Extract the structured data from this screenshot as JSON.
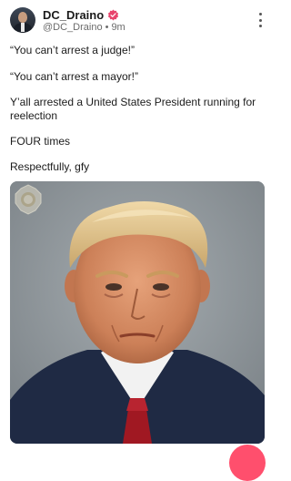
{
  "post": {
    "author": {
      "display_name": "DC_Draino",
      "handle": "@DC_Draino",
      "time_ago": "9m",
      "separator": "•"
    },
    "lines": [
      "“You can’t arrest a judge!”",
      "“You can’t arrest a mayor!”",
      "Y’all arrested a United States President running for reelection",
      "FOUR times",
      "Respectfully, gfy"
    ]
  },
  "icons": {
    "verified": "verified-badge-icon",
    "more": "more-vertical-icon"
  },
  "colors": {
    "verified": "#e8436c",
    "fab": "#ff4f6d",
    "text": "#1b1b1b",
    "meta": "#6b6b6b"
  }
}
